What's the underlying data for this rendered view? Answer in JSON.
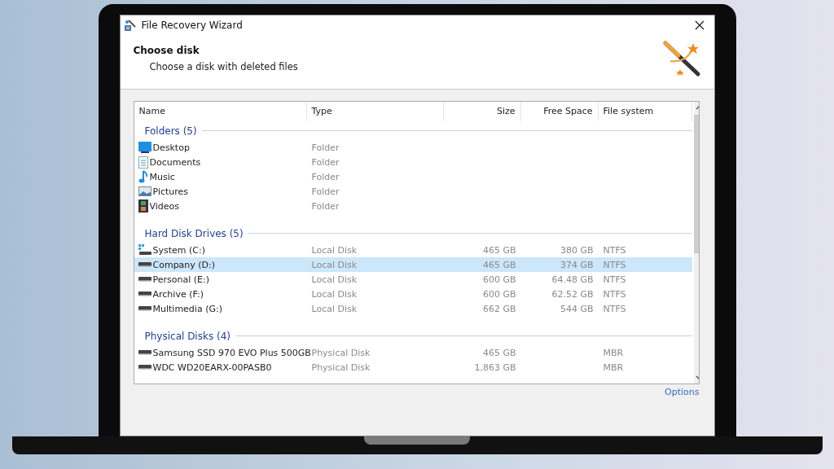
{
  "window": {
    "title": "File Recovery Wizard"
  },
  "header": {
    "title": "Choose disk",
    "subtitle": "Choose a disk with deleted files"
  },
  "table": {
    "columns": [
      "Name",
      "Type",
      "Size",
      "Free Space",
      "File system"
    ],
    "groups": [
      {
        "label": "Folders (5)",
        "rows": [
          {
            "kind": "desktop",
            "name": "Desktop",
            "type": "Folder",
            "selected": false
          },
          {
            "kind": "documents",
            "name": "Documents",
            "type": "Folder",
            "selected": false
          },
          {
            "kind": "music",
            "name": "Music",
            "type": "Folder",
            "selected": false
          },
          {
            "kind": "pictures",
            "name": "Pictures",
            "type": "Folder",
            "selected": false
          },
          {
            "kind": "videos",
            "name": "Videos",
            "type": "Folder",
            "selected": false
          }
        ]
      },
      {
        "label": "Hard Disk Drives (5)",
        "rows": [
          {
            "kind": "system-drive",
            "name": "System (C:)",
            "type": "Local Disk",
            "size": "465 GB",
            "free": "380 GB",
            "fs": "NTFS",
            "selected": false
          },
          {
            "kind": "drive",
            "name": "Company (D:)",
            "type": "Local Disk",
            "size": "465 GB",
            "free": "374 GB",
            "fs": "NTFS",
            "selected": true
          },
          {
            "kind": "drive",
            "name": "Personal (E:)",
            "type": "Local Disk",
            "size": "600 GB",
            "free": "64.48 GB",
            "fs": "NTFS",
            "selected": false
          },
          {
            "kind": "drive",
            "name": "Archive (F:)",
            "type": "Local Disk",
            "size": "600 GB",
            "free": "62.52 GB",
            "fs": "NTFS",
            "selected": false
          },
          {
            "kind": "drive",
            "name": "Multimedia (G:)",
            "type": "Local Disk",
            "size": "662 GB",
            "free": "544 GB",
            "fs": "NTFS",
            "selected": false
          }
        ]
      },
      {
        "label": "Physical Disks (4)",
        "rows": [
          {
            "kind": "drive",
            "name": "Samsung SSD 970 EVO Plus 500GB",
            "type": "Physical Disk",
            "size": "465 GB",
            "fs": "MBR",
            "selected": false
          },
          {
            "kind": "drive",
            "name": "WDC WD20EARX-00PASB0",
            "type": "Physical Disk",
            "size": "1,863 GB",
            "fs": "MBR",
            "selected": false
          }
        ]
      }
    ]
  },
  "options_link": "Options"
}
